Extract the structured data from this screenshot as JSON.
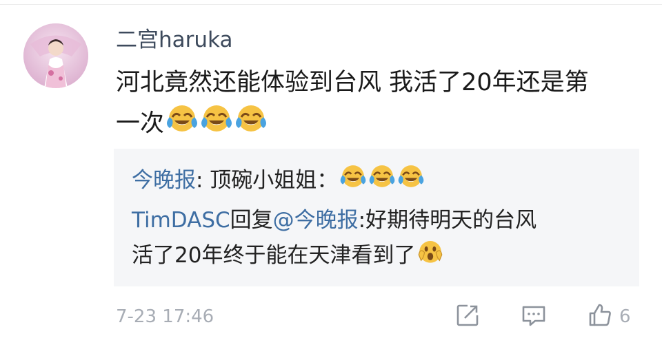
{
  "comment": {
    "username": "二宫haruka",
    "line1": "河北竟然还能体验到台风 我活了20年还是第",
    "line2": "一次",
    "emojis": [
      "laugh-cry-emoji",
      "laugh-cry-emoji",
      "laugh-cry-emoji"
    ]
  },
  "replies": [
    {
      "user": "今晚报",
      "sep": ":",
      "text": " 顶碗小姐姐：",
      "emojis": [
        "laugh-cry-emoji",
        "laugh-cry-emoji",
        "laugh-cry-emoji"
      ]
    },
    {
      "user": "TimDASC",
      "reply_word": "回复",
      "mention": "@今晚报",
      "sep": ":",
      "text": "好期待明天的台风",
      "continued": "活了20年终于能在天津看到了",
      "emojis": [
        "scream-emoji"
      ]
    }
  ],
  "footer": {
    "timestamp": "7-23 17:46",
    "like_count": "6"
  },
  "icons": [
    "share-icon",
    "comment-icon",
    "like-icon"
  ],
  "colors": {
    "link_blue": "#3e6ea3",
    "username_gray": "#3d4a5c",
    "meta_gray": "#a8adb5",
    "reply_bg": "#f5f6f8",
    "emoji_yellow": "#f6c344",
    "tear_blue": "#4aa3e0"
  }
}
